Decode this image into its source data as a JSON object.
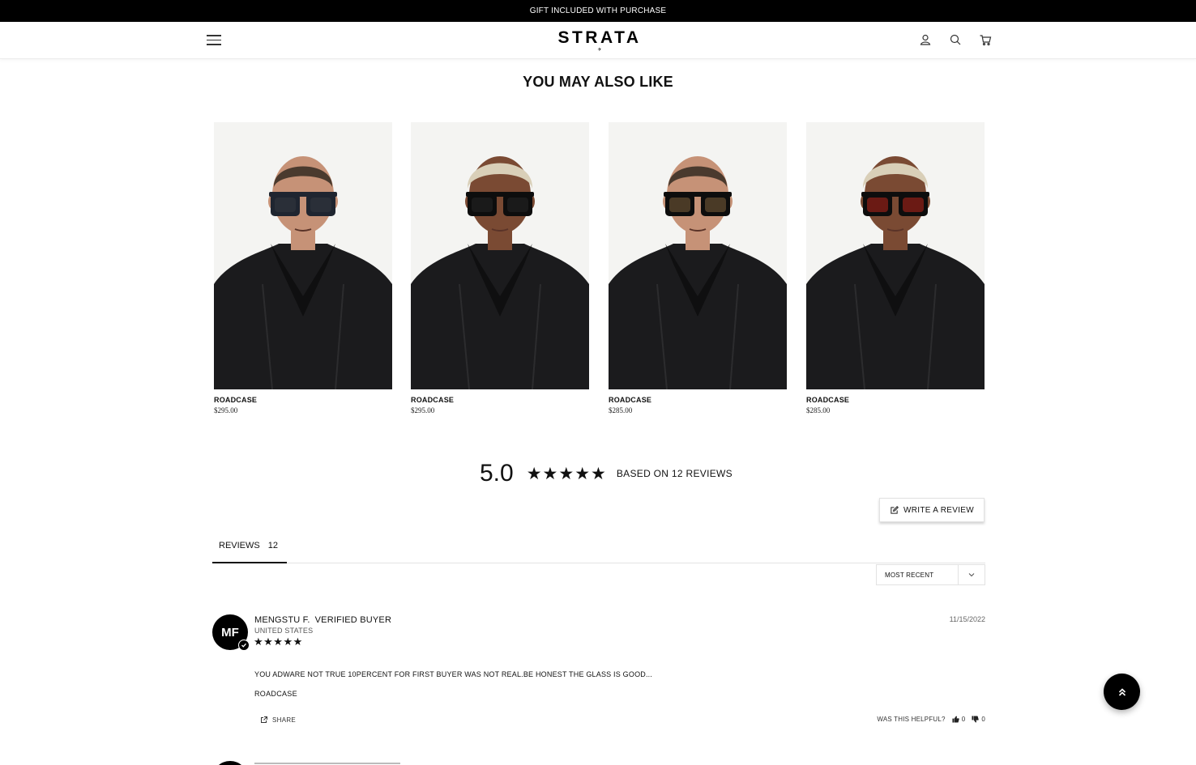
{
  "announcement": "GIFT INCLUDED WITH PURCHASE",
  "header": {
    "logo": "STRATA",
    "logo_mark": "✈"
  },
  "section_title": "YOU MAY ALSO LIKE",
  "products": [
    {
      "name": "ROADCASE",
      "price": "$295.00",
      "model": "man",
      "frame_color": "#1f2530",
      "lens_color": "#2a2f38"
    },
    {
      "name": "ROADCASE",
      "price": "$295.00",
      "model": "woman",
      "frame_color": "#0d0d0d",
      "lens_color": "#1a1a1a"
    },
    {
      "name": "ROADCASE",
      "price": "$285.00",
      "model": "man",
      "frame_color": "#0d0d0d",
      "lens_color": "#4a3a26"
    },
    {
      "name": "ROADCASE",
      "price": "$285.00",
      "model": "woman",
      "frame_color": "#0d0d0d",
      "lens_color": "#6b1a14"
    }
  ],
  "reviews_summary": {
    "average": "5.0",
    "stars": "★★★★★",
    "based_on": "BASED ON 12 REVIEWS",
    "write_review": "WRITE A REVIEW"
  },
  "tabs": [
    {
      "label": "REVIEWS",
      "count": "12"
    }
  ],
  "sort": {
    "selected": "MOST RECENT"
  },
  "reviews": [
    {
      "initials": "MF",
      "name": "MENGSTU F.",
      "verified": "VERIFIED BUYER",
      "location": "UNITED STATES",
      "stars": "★★★★★",
      "date": "11/15/2022",
      "body": "YOU ADWARE NOT TRUE 10PERCENT FOR FIRST BUYER WAS NOT REAL.BE HONEST THE GLASS IS GOOD...",
      "product": "ROADCASE",
      "share_label": "SHARE",
      "helpful_label": "WAS THIS HELPFUL?",
      "upvotes": "0",
      "downvotes": "0"
    }
  ],
  "colors": {
    "black": "#000000",
    "skin_man": "#c69277",
    "skin_woman": "#7a4a33",
    "hair_woman": "#d9cfb8",
    "hair_man": "#4a3a2e"
  }
}
